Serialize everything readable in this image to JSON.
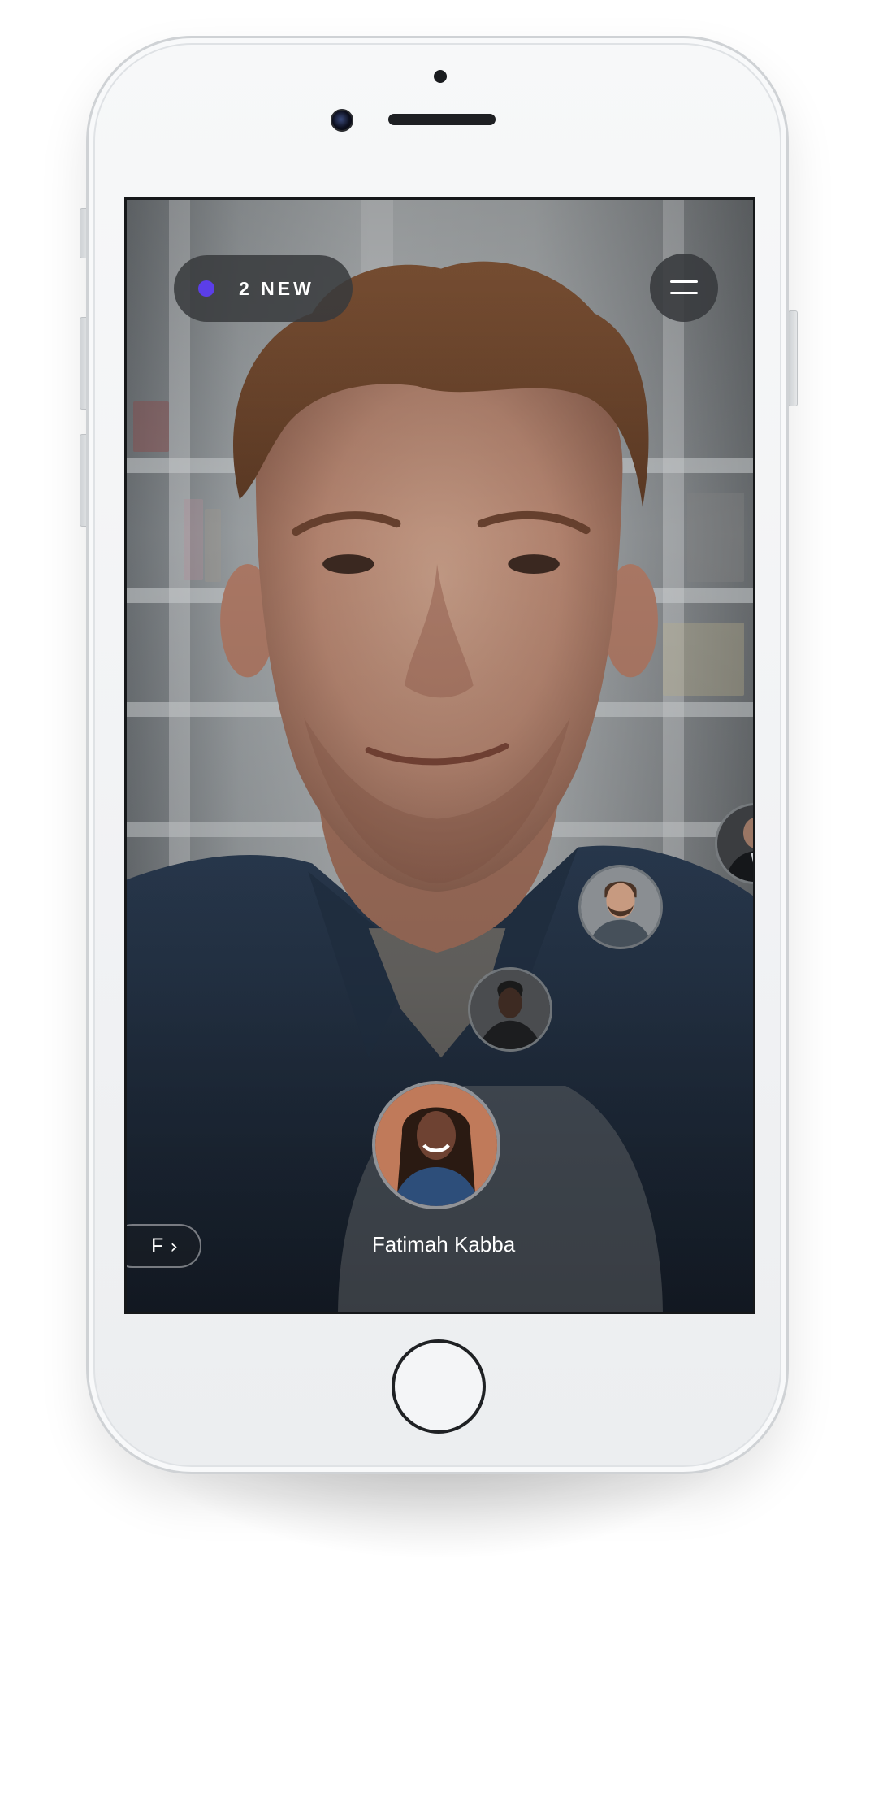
{
  "header": {
    "new_badge": {
      "label": "2 NEW",
      "dot_color": "#5b3ee8"
    },
    "menu_icon": "hamburger-menu-icon"
  },
  "contacts": {
    "selected": {
      "name": "Fatimah Kabba"
    },
    "bubbles": [
      {
        "id": "fatimah",
        "icon": "avatar-photo"
      },
      {
        "id": "contact-2",
        "icon": "avatar-photo"
      },
      {
        "id": "contact-3",
        "icon": "avatar-photo"
      },
      {
        "id": "contact-4",
        "icon": "avatar-photo"
      }
    ]
  },
  "index_tab": {
    "letter": "F",
    "chevron": "›"
  },
  "colors": {
    "accent": "#5b3ee8",
    "pill_bg": "#37393c",
    "text": "#ffffff"
  }
}
